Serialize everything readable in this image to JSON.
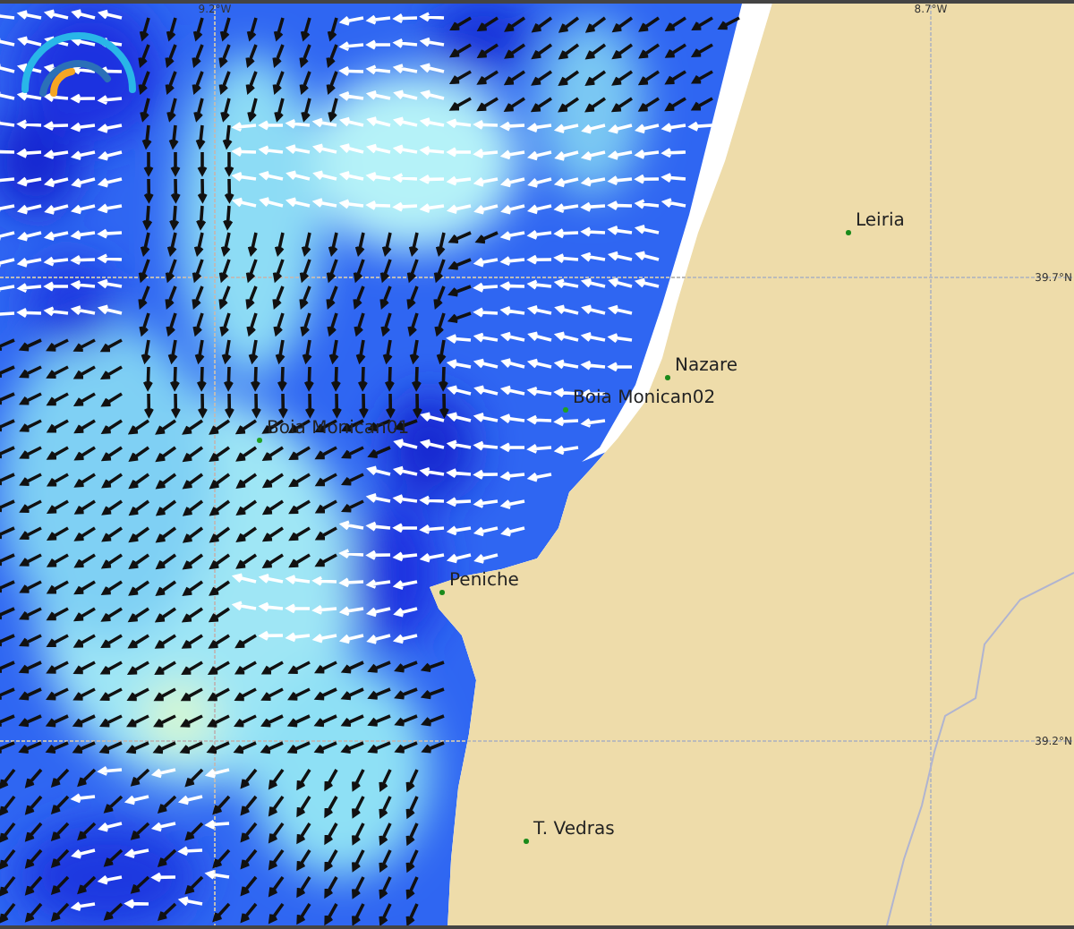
{
  "map": {
    "graticule_labels": [
      {
        "kind": "lon",
        "text": "9.2°W"
      },
      {
        "kind": "lon",
        "text": "8.7°W"
      },
      {
        "kind": "lat",
        "text": "39.7°N"
      },
      {
        "kind": "lat",
        "text": "39.2°N"
      }
    ],
    "places": [
      {
        "kind": "city",
        "name": "Leiria"
      },
      {
        "kind": "city",
        "name": "Nazare"
      },
      {
        "kind": "buoy",
        "name": "Boia Monican02"
      },
      {
        "kind": "buoy",
        "name": "Boia Monican01"
      },
      {
        "kind": "city",
        "name": "Peniche"
      },
      {
        "kind": "city",
        "name": "T. Vedras"
      }
    ]
  }
}
